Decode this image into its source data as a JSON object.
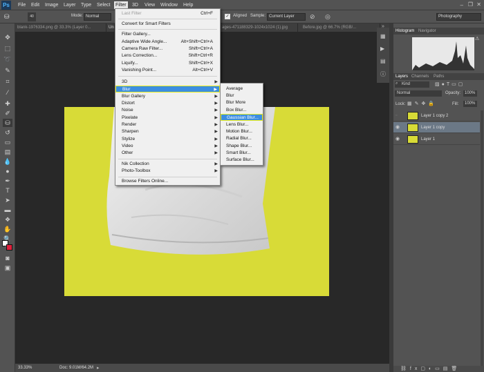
{
  "app": {
    "logo": "Ps"
  },
  "menubar": [
    "File",
    "Edit",
    "Image",
    "Layer",
    "Type",
    "Select",
    "Filter",
    "3D",
    "View",
    "Window",
    "Help"
  ],
  "options": {
    "mode_label": "Mode:",
    "mode_value": "Normal",
    "aligned_label": "Aligned",
    "sample_label": "Sample:",
    "sample_value": "Current Layer",
    "workspace": "Photography",
    "brush_size": "40"
  },
  "doc_tabs": [
    "blank-1976334.png @ 33.3% (Layer 0...",
    "Un",
    "ages-471188329-1024x1024 (1).jpg",
    "Before.jpg @ 66.7% (RGB/..."
  ],
  "filter_menu": {
    "last_filter": "Last Filter",
    "last_filter_sc": "Ctrl+F",
    "convert": "Convert for Smart Filters",
    "gallery": "Filter Gallery...",
    "adaptive": "Adaptive Wide Angle...",
    "adaptive_sc": "Alt+Shift+Ctrl+A",
    "camera_raw": "Camera Raw Filter...",
    "camera_raw_sc": "Shift+Ctrl+A",
    "lens_corr": "Lens Correction...",
    "lens_corr_sc": "Shift+Ctrl+R",
    "liquify": "Liquify...",
    "liquify_sc": "Shift+Ctrl+X",
    "vanishing": "Vanishing Point...",
    "vanishing_sc": "Alt+Ctrl+V",
    "submenus": [
      "3D",
      "Blur",
      "Blur Gallery",
      "Distort",
      "Noise",
      "Pixelate",
      "Render",
      "Sharpen",
      "Stylize",
      "Video",
      "Other"
    ],
    "nik": "Nik Collection",
    "photo_toolbox": "Photo-Toolbox",
    "browse": "Browse Filters Online..."
  },
  "blur_menu": [
    "Average",
    "Blur",
    "Blur More",
    "Box Blur...",
    "Gaussian Blur...",
    "Lens Blur...",
    "Motion Blur...",
    "Radial Blur...",
    "Shape Blur...",
    "Smart Blur...",
    "Surface Blur..."
  ],
  "status": {
    "zoom": "33.33%",
    "doc": "Doc: 9.01M/64.2M"
  },
  "panels": {
    "top_tabs": [
      "Histogram",
      "Navigator"
    ],
    "layer_tabs": [
      "Layers",
      "Channels",
      "Paths"
    ],
    "kind": "Kind",
    "blend": "Normal",
    "opacity_label": "Opacity:",
    "opacity": "100%",
    "lock_label": "Lock:",
    "fill_label": "Fill:",
    "fill": "100%",
    "layers": [
      "Layer 1 copy 2",
      "Layer 1 copy",
      "Layer 1"
    ]
  },
  "colors": {
    "canvas": "#d8db37",
    "highlight": "#3c8ee0",
    "callout": "#e8ee1a"
  }
}
